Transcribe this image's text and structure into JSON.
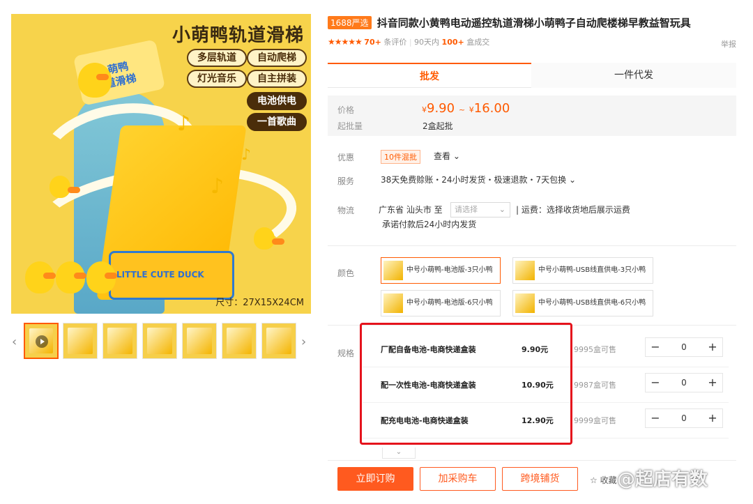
{
  "gallery": {
    "headline": "小萌鸭轨道滑梯",
    "tags": [
      "多层轨道",
      "自动爬梯",
      "灯光音乐",
      "自主拼装",
      "电池供电",
      "一首歌曲"
    ],
    "sign_line1": "小萌鸭",
    "sign_line2": "轨道滑梯",
    "base_text": "LITTLE CUTE DUCK",
    "size_text": "尺寸：27X15X24CM",
    "prev_icon": "‹",
    "next_icon": "›",
    "thumbnail_count": 7
  },
  "product": {
    "badge": "1688严选",
    "title": "抖音同款小黄鸭电动遥控轨道滑梯小萌鸭子自动爬楼梯早教益智玩具",
    "stars": "★★★★★",
    "review_count": "70+",
    "review_label": "条评价",
    "period_label": "90天内",
    "sold_count": "100+",
    "sold_label": "盒成交",
    "report": "举报"
  },
  "tabs": {
    "wholesale": "批发",
    "dropship": "一件代发"
  },
  "price": {
    "label": "价格",
    "currency": "¥",
    "low": "9.90",
    "sep": "~",
    "high": "16.00",
    "min_label": "起批量",
    "min_value": "2盒起批"
  },
  "promo": {
    "label": "优惠",
    "tag": "10件混批",
    "view": "查看 ⌄"
  },
  "service": {
    "label": "服务",
    "text": "38天免费赊账・24小时发货・极速退款・7天包换 ⌄"
  },
  "logistics": {
    "label": "物流",
    "origin": "广东省 汕头市  至",
    "select_placeholder": "请选择",
    "freight": "|  运费：选择收货地后展示运费",
    "promise": "承诺付款后24小时内发货"
  },
  "colors": {
    "label": "颜色",
    "items": [
      "中号小萌鸭-电池版-3只小鸭",
      "中号小萌鸭-USB线直供电-3只小鸭",
      "中号小萌鸭-电池版-6只小鸭",
      "中号小萌鸭-USB线直供电-6只小鸭"
    ]
  },
  "specs": {
    "label": "规格",
    "rows": [
      {
        "name": "厂配自备电池-电商快递盒装",
        "price": "9.90元",
        "stock": "9995盒可售",
        "qty": "0"
      },
      {
        "name": "配一次性电池-电商快递盒装",
        "price": "10.90元",
        "stock": "9987盒可售",
        "qty": "0"
      },
      {
        "name": "配充电电池-电商快递盒装",
        "price": "12.90元",
        "stock": "9999盒可售",
        "qty": "0"
      }
    ],
    "minus": "−",
    "plus": "+",
    "expand": "⌄"
  },
  "actions": {
    "order": "立即订购",
    "cart": "加采购车",
    "cross": "跨境铺货",
    "favorite": "☆ 收藏"
  },
  "watermark": "@超店有数",
  "colors_theme": {
    "accent": "#ff5a00",
    "highlight_frame": "#e5131c"
  }
}
